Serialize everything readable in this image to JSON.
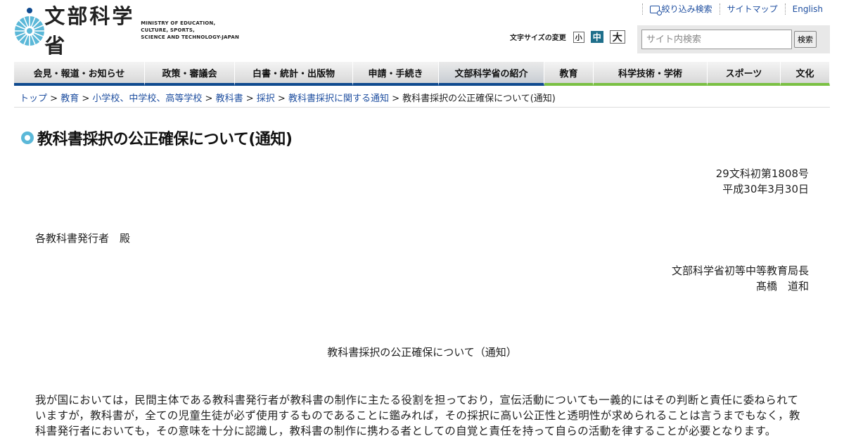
{
  "header": {
    "logo_text": "文部科学省",
    "logo_en": [
      "MINISTRY OF EDUCATION,",
      "CULTURE, SPORTS,",
      "SCIENCE AND TECHNOLOGY-JAPAN"
    ],
    "utility": [
      {
        "label": "絞り込み検索",
        "icon": "filter-search-icon"
      },
      {
        "label": "サイトマップ"
      },
      {
        "label": "English"
      }
    ],
    "fontsize_label": "文字サイズの変更",
    "fontsize_small": "小",
    "fontsize_mid": "中",
    "fontsize_large": "大",
    "search_placeholder": "サイト内検索",
    "search_button": "検索"
  },
  "nav": [
    "会見・報道・お知らせ",
    "政策・審議会",
    "白書・統計・出版物",
    "申請・手続き",
    "文部科学省の紹介",
    "教育",
    "科学技術・学術",
    "スポーツ",
    "文化"
  ],
  "breadcrumb": [
    "トップ",
    "教育",
    "小学校、中学校、高等学校",
    "教科書",
    "採択",
    "教科書採択に関する通知",
    "教科書採択の公正確保について(通知)"
  ],
  "page": {
    "title": "教科書採択の公正確保について(通知)",
    "doc_number": "29文科初第1808号",
    "date": "平成30年3月30日",
    "addressee": "各教科書発行者　殿",
    "sender_title": "文部科学省初等中等教育局長",
    "sender_name": "髙橋　道和",
    "subject": "教科書採択の公正確保について（通知）",
    "body": "我が国においては，民間主体である教科書発行者が教科書の制作に主たる役割を担っており，宣伝活動についても一義的にはその判断と責任に委ねられていますが，教科書が，全ての児童生徒が必ず使用するものであることに鑑みれば，その採択に高い公正性と透明性が求められることは言うまでもなく，教科書発行者においても，その意味を十分に認識し，教科書の制作に携わる者としての自覚と責任を持って自らの活動を律することが必要となります。"
  },
  "colors": {
    "nav_blue": "#0f4a8f",
    "nav_green": "#7ac043",
    "link": "#1f4fa0",
    "accent": "#5bb8d8"
  }
}
